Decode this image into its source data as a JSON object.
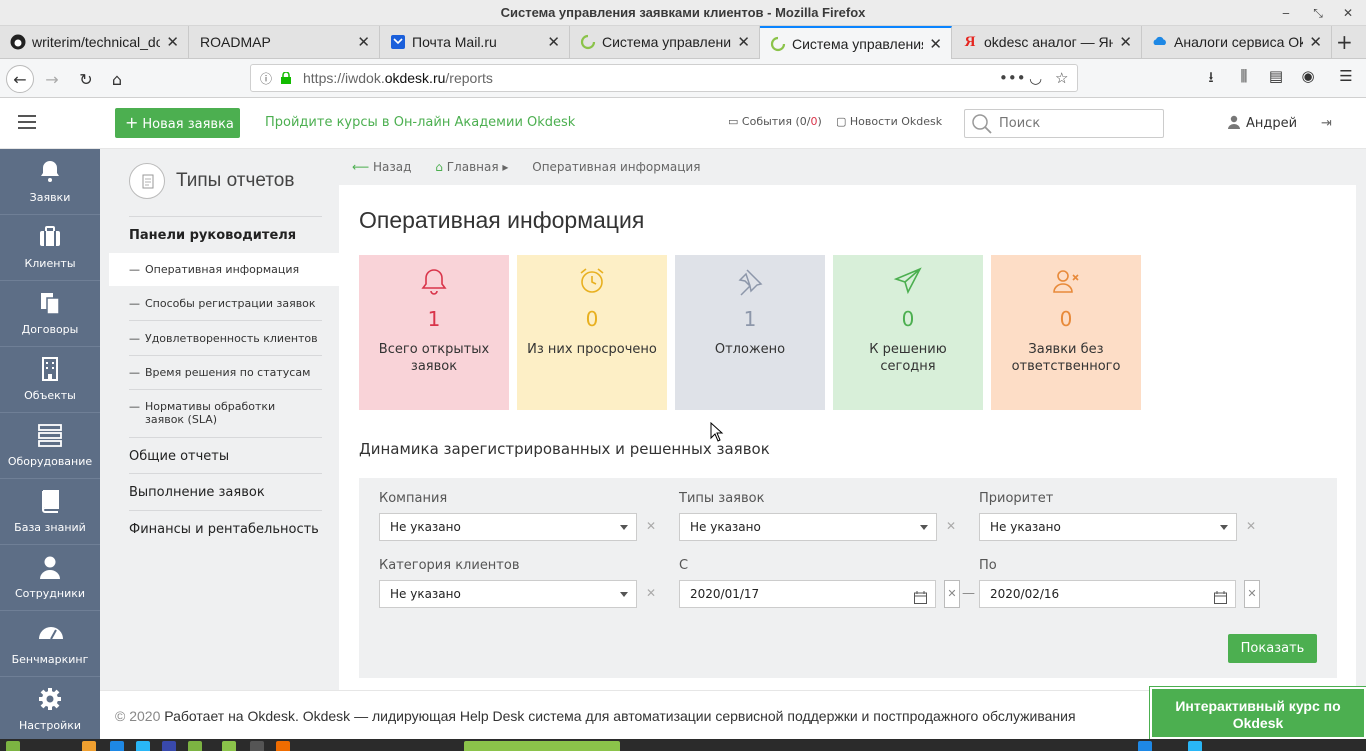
{
  "window": {
    "title": "Система управления заявками клиентов - Mozilla Firefox"
  },
  "tabs": [
    {
      "label": "writerim/technical_do",
      "icon": "github-icon"
    },
    {
      "label": "ROADMAP",
      "icon": "none"
    },
    {
      "label": "Почта Mail.ru",
      "icon": "mail-icon"
    },
    {
      "label": "Система управления",
      "icon": "okdesk-icon"
    },
    {
      "label": "Система управления",
      "icon": "okdesk-icon",
      "active": true
    },
    {
      "label": "okdesc аналог — Янд",
      "icon": "yandex-icon"
    },
    {
      "label": "Аналоги сервиса Okd",
      "icon": "cloud-icon"
    }
  ],
  "url": {
    "prefix": "https://iwdok.",
    "domain": "okdesk.ru",
    "path": "/reports"
  },
  "header": {
    "new_request": "Новая заявка",
    "academy_link": "Пройдите курсы в Он-лайн Академии Okdesk",
    "events_label": "События (",
    "events_count_a": "0",
    "events_slash": "/",
    "events_count_b": "0",
    "events_close": ")",
    "news_label": "Новости Okdesk",
    "search_placeholder": "Поиск",
    "user_name": "Андрей"
  },
  "sidebar": [
    {
      "label": "Заявки",
      "icon": "bell-icon"
    },
    {
      "label": "Клиенты",
      "icon": "briefcase-icon"
    },
    {
      "label": "Договоры",
      "icon": "documents-icon"
    },
    {
      "label": "Объекты",
      "icon": "building-icon"
    },
    {
      "label": "Оборудование",
      "icon": "server-icon"
    },
    {
      "label": "База знаний",
      "icon": "book-icon"
    },
    {
      "label": "Сотрудники",
      "icon": "person-icon"
    },
    {
      "label": "Бенчмаркинг",
      "icon": "gauge-icon"
    },
    {
      "label": "Настройки",
      "icon": "gear-icon"
    }
  ],
  "reports": {
    "title": "Типы отчетов",
    "section_manager": "Панели руководителя",
    "sub_items": [
      "Оперативная информация",
      "Способы регистрации заявок",
      "Удовлетворенность клиентов",
      "Время решения по статусам",
      "Нормативы обработки заявок (SLA)"
    ],
    "section_general": "Общие отчеты",
    "section_execution": "Выполнение заявок",
    "section_finance": "Финансы и рентабельность"
  },
  "breadcrumb": {
    "back": "Назад",
    "home": "Главная",
    "current": "Оперативная информация"
  },
  "main": {
    "title": "Оперативная информация",
    "cards": [
      {
        "value": "1",
        "label": "Всего открытых заявок",
        "icon": "bell-icon",
        "bg": "#f9d3d8",
        "color": "#d9344a"
      },
      {
        "value": "0",
        "label": "Из них просрочено",
        "icon": "alarm-clock-icon",
        "bg": "#fdefc6",
        "color": "#e8b020"
      },
      {
        "value": "1",
        "label": "Отложено",
        "icon": "pin-icon",
        "bg": "#dfe2e8",
        "color": "#8d97aa"
      },
      {
        "value": "0",
        "label": "К решению сегодня",
        "icon": "paper-plane-icon",
        "bg": "#d8efd9",
        "color": "#4caf50"
      },
      {
        "value": "0",
        "label": "Заявки без ответственного",
        "icon": "user-x-icon",
        "bg": "#fdddc6",
        "color": "#e88a3a"
      }
    ],
    "dynamics_title": "Динамика зарегистрированных и решенных заявок",
    "filters": {
      "company_label": "Компания",
      "company_value": "Не указано",
      "types_label": "Типы заявок",
      "types_value": "Не указано",
      "priority_label": "Приоритет",
      "priority_value": "Не указано",
      "category_label": "Категория клиентов",
      "category_value": "Не указано",
      "from_label": "С",
      "from_value": "2020/01/17",
      "to_label": "По",
      "to_value": "2020/02/16",
      "date_dash": "—",
      "show_button": "Показать"
    }
  },
  "footer": {
    "copyright": "© 2020",
    "text": "Работает на Okdesk. Okdesk — лидирующая Help Desk система для автоматизации сервисной поддержки и постпродажного обслуживания",
    "course_button": "Интерактивный курс по Okdesk"
  },
  "colors": {
    "accent": "#4caf50",
    "sidebar": "#5d6e86",
    "firefox_blue": "#0a84ff"
  }
}
